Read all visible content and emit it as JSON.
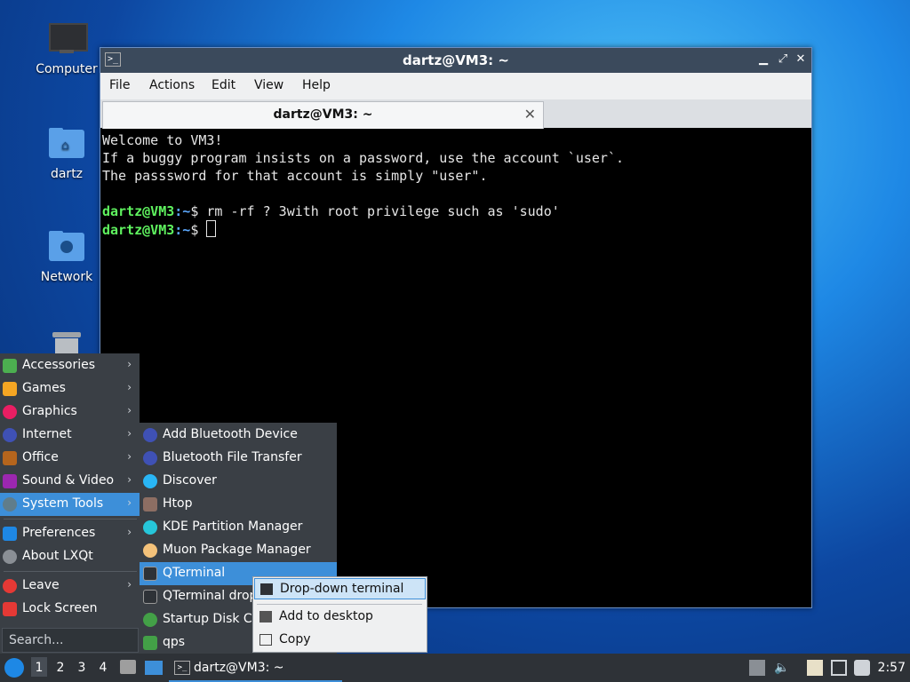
{
  "desktop": {
    "icons": [
      {
        "label": "Computer"
      },
      {
        "label": "dartz"
      },
      {
        "label": "Network"
      },
      {
        "label": "Trash"
      }
    ]
  },
  "window": {
    "title": "dartz@VM3: ~",
    "menu": [
      "File",
      "Actions",
      "Edit",
      "View",
      "Help"
    ],
    "tab_label": "dartz@VM3: ~",
    "terminal": {
      "lines": [
        "Welcome to VM3!",
        "If a buggy program insists on a password, use the account `user`.",
        "The passsword for that account is simply \"user\"."
      ],
      "prompt_user": "dartz@VM3",
      "prompt_path": ":~",
      "prompt_symbol": "$",
      "command1": " rm -rf ? 3with root privilege such as 'sudo'",
      "command2": " "
    }
  },
  "start_menu": {
    "items": [
      {
        "label": "Accessories",
        "icon": "accessories-icon",
        "color": "#4caf50"
      },
      {
        "label": "Games",
        "icon": "games-icon",
        "color": "#f5a623"
      },
      {
        "label": "Graphics",
        "icon": "graphics-icon",
        "color": "#e91e63"
      },
      {
        "label": "Internet",
        "icon": "internet-icon",
        "color": "#3f51b5"
      },
      {
        "label": "Office",
        "icon": "office-icon",
        "color": "#b5651d"
      },
      {
        "label": "Sound & Video",
        "icon": "sound-video-icon",
        "color": "#9c27b0"
      },
      {
        "label": "System Tools",
        "icon": "system-tools-icon",
        "color": "#607d8b"
      },
      {
        "label": "Preferences",
        "icon": "preferences-icon",
        "color": "#1e88e5"
      },
      {
        "label": "About LXQt",
        "icon": "about-icon",
        "color": "#8a8f95"
      },
      {
        "label": "Leave",
        "icon": "leave-icon",
        "color": "#e53935"
      },
      {
        "label": "Lock Screen",
        "icon": "lock-icon",
        "color": "#e53935"
      }
    ],
    "search_placeholder": "Search..."
  },
  "submenu": {
    "items": [
      {
        "label": "Add Bluetooth Device",
        "icon": "bluetooth-icon",
        "color": "#3f51b5"
      },
      {
        "label": "Bluetooth File Transfer",
        "icon": "bluetooth-icon",
        "color": "#3f51b5"
      },
      {
        "label": "Discover",
        "icon": "discover-icon",
        "color": "#29b6f6"
      },
      {
        "label": "Htop",
        "icon": "htop-icon",
        "color": "#8d6e63"
      },
      {
        "label": "KDE Partition Manager",
        "icon": "partition-icon",
        "color": "#26c6da"
      },
      {
        "label": "Muon Package Manager",
        "icon": "muon-icon",
        "color": "#f4c27a"
      },
      {
        "label": "QTerminal",
        "icon": "terminal-icon",
        "color": "#2e3237"
      },
      {
        "label": "QTerminal drop",
        "icon": "terminal-icon",
        "color": "#2e3237"
      },
      {
        "label": "Startup Disk Cr",
        "icon": "startup-disk-icon",
        "color": "#43a047"
      },
      {
        "label": "qps",
        "icon": "qps-icon",
        "color": "#43a047"
      }
    ]
  },
  "context_menu": {
    "items": [
      {
        "label": "Drop-down terminal",
        "icon": "terminal-icon"
      },
      {
        "label": "Add to desktop",
        "icon": "desktop-icon"
      },
      {
        "label": "Copy",
        "icon": "copy-icon"
      }
    ]
  },
  "taskbar": {
    "desktops": [
      "1",
      "2",
      "3",
      "4"
    ],
    "task_label": "dartz@VM3: ~",
    "clock": "2:57"
  }
}
